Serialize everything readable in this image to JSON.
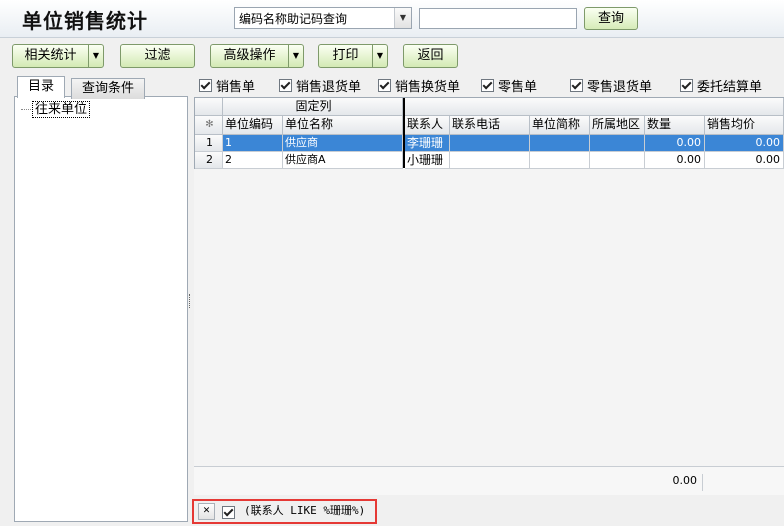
{
  "header": {
    "title": "单位销售统计",
    "search_mode": "编码名称助记码查询",
    "search_value": "",
    "query_label": "查询"
  },
  "toolbar": {
    "related_stats": "相关统计",
    "filter": "过滤",
    "advanced": "高级操作",
    "print": "打印",
    "back": "返回"
  },
  "left_panel": {
    "tabs": [
      "目录",
      "查询条件"
    ],
    "tree_root": "往来单位"
  },
  "doc_types": [
    {
      "label": "销售单",
      "checked": true
    },
    {
      "label": "销售退货单",
      "checked": true
    },
    {
      "label": "销售换货单",
      "checked": true
    },
    {
      "label": "零售单",
      "checked": true
    },
    {
      "label": "零售退货单",
      "checked": true
    },
    {
      "label": "委托结算单",
      "checked": true
    }
  ],
  "grid": {
    "frozen_header": "固定列",
    "row_marker": "✻",
    "columns": [
      "单位编码",
      "单位名称",
      "联系人",
      "联系电话",
      "单位简称",
      "所属地区",
      "数量",
      "销售均价"
    ],
    "rows": [
      {
        "idx": "1",
        "code": "1",
        "name": "供应商",
        "contact": "李珊珊",
        "phone": "",
        "short": "",
        "region": "",
        "qty": "0.00",
        "avg": "0.00",
        "selected": true
      },
      {
        "idx": "2",
        "code": "2",
        "name": "供应商A",
        "contact": "小珊珊",
        "phone": "",
        "short": "",
        "region": "",
        "qty": "0.00",
        "avg": "0.00",
        "selected": false
      }
    ],
    "total_qty": "0.00"
  },
  "filter_bar": {
    "close_glyph": "✕",
    "enabled": true,
    "expression": "(联系人 LIKE %珊珊%)"
  },
  "colors": {
    "selected_row": "#3b86d6",
    "button_green": "#d3eab4",
    "highlight": "#e53935"
  }
}
